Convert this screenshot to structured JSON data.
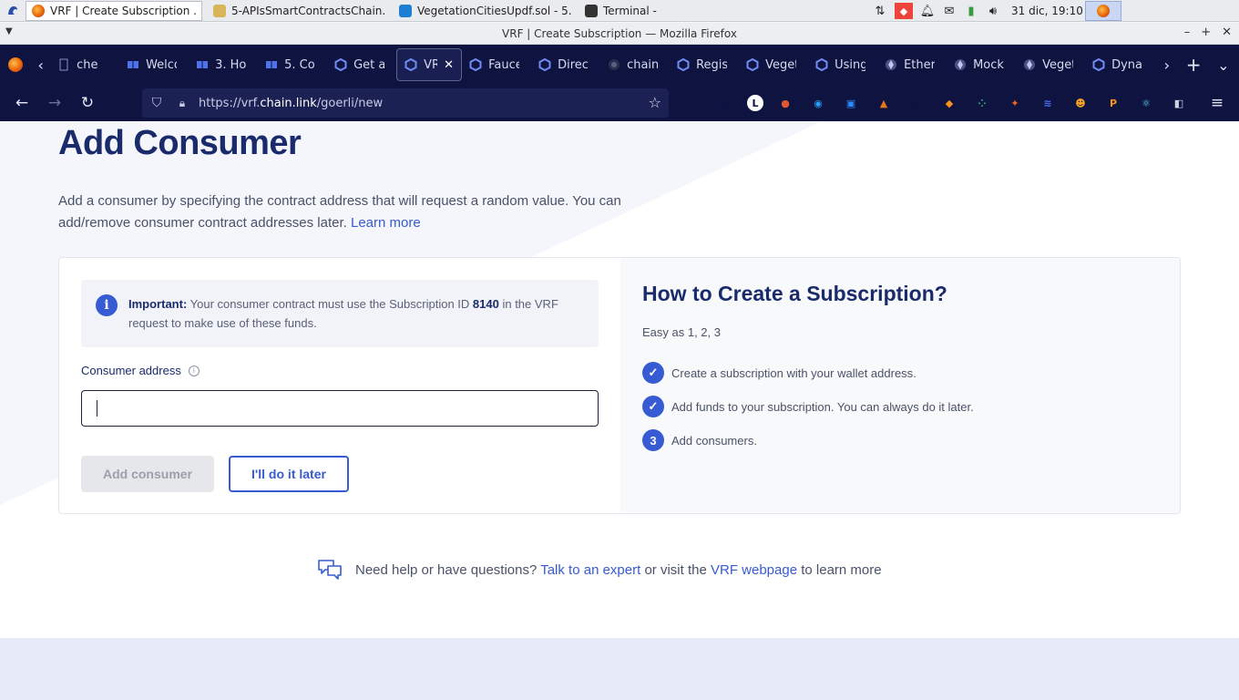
{
  "taskbar": {
    "tasks": [
      {
        "label": "VRF | Create Subscription ...",
        "color": "#e66000"
      },
      {
        "label": "5-APIsSmartContractsChain...",
        "color": "#d8b45a"
      },
      {
        "label": "VegetationCitiesUpdf.sol - 5...",
        "color": "#1f7fd3"
      },
      {
        "label": "Terminal -",
        "color": "#333333"
      }
    ],
    "clock": "31 dic, 19:10"
  },
  "window": {
    "title": "VRF | Create Subscription — Mozilla Firefox"
  },
  "tabs": [
    {
      "label": "che",
      "icon": "doc-icon"
    },
    {
      "label": "Welco",
      "icon": "book-icon"
    },
    {
      "label": "3. Ho",
      "icon": "book-icon"
    },
    {
      "label": "5. Co",
      "icon": "book-icon"
    },
    {
      "label": "Get a",
      "icon": "chainlink-icon"
    },
    {
      "label": "VRF",
      "icon": "chainlink-icon"
    },
    {
      "label": "Fauce",
      "icon": "chainlink-icon"
    },
    {
      "label": "Direct",
      "icon": "chainlink-icon"
    },
    {
      "label": "chainl",
      "icon": "github-icon"
    },
    {
      "label": "Regist",
      "icon": "chainlink-icon"
    },
    {
      "label": "Veget",
      "icon": "chainlink-icon"
    },
    {
      "label": "Using",
      "icon": "chainlink-icon"
    },
    {
      "label": "Ether",
      "icon": "ethereum-icon"
    },
    {
      "label": "Mock",
      "icon": "ethereum-icon"
    },
    {
      "label": "Veget",
      "icon": "ethereum-icon"
    },
    {
      "label": "Dynar",
      "icon": "chainlink-icon"
    }
  ],
  "url": {
    "prefix": "https://vrf.",
    "host": "chain.link",
    "path": "/goerli/new"
  },
  "extensions": [
    {
      "name": "pocket-icon",
      "color": "#0f1340",
      "glyph": "◙"
    },
    {
      "name": "l-extension-icon",
      "color": "#ffffff",
      "glyph": "L"
    },
    {
      "name": "duckduckgo-icon",
      "color": "#de5833",
      "glyph": "●"
    },
    {
      "name": "privacy-icon",
      "color": "#2a9df4",
      "glyph": "◉"
    },
    {
      "name": "zoom-icon",
      "color": "#2d8cff",
      "glyph": "▣"
    },
    {
      "name": "metamask-icon",
      "color": "#e2761b",
      "glyph": "▲"
    },
    {
      "name": "grid-icon",
      "color": "#0f1340",
      "glyph": "▦"
    },
    {
      "name": "shield-orange-icon",
      "color": "#f7931a",
      "glyph": "◆"
    },
    {
      "name": "dots-icon",
      "color": "#2fbf71",
      "glyph": "⁘"
    },
    {
      "name": "rocket-icon",
      "color": "#f26522",
      "glyph": "✦"
    },
    {
      "name": "layers-icon",
      "color": "#4a6cf7",
      "glyph": "≋"
    },
    {
      "name": "avatar-ext-icon",
      "color": "#f5a623",
      "glyph": "☻"
    },
    {
      "name": "coin-icon",
      "color": "#f7931a",
      "glyph": "P"
    },
    {
      "name": "react-icon",
      "color": "#61dafb",
      "glyph": "⚛"
    },
    {
      "name": "box-icon",
      "color": "#cfd2e4",
      "glyph": "◧"
    }
  ],
  "page": {
    "title": "Add Consumer",
    "intro": "Add a consumer by specifying the contract address that will request a random value. You can add/remove consumer contract addresses later.",
    "learn_more": "Learn more",
    "notice_bold": "Important:",
    "notice_pre": "Your consumer contract must use the Subscription ID",
    "sub_id": "8140",
    "notice_post": "in the VRF request to make use of these funds.",
    "address_label": "Consumer address",
    "address_value": "",
    "add_button": "Add consumer",
    "later_button": "I'll do it later",
    "how_title": "How to Create a Subscription?",
    "how_sub": "Easy as 1, 2, 3",
    "steps": [
      {
        "mark": "✓",
        "text": "Create a subscription with your wallet address."
      },
      {
        "mark": "✓",
        "text": "Add funds to your subscription. You can always do it later."
      },
      {
        "mark": "3",
        "text": "Add consumers."
      }
    ],
    "help_pre": "Need help or have questions?",
    "help_link1": "Talk to an expert",
    "help_mid": "or visit the",
    "help_link2": "VRF webpage",
    "help_post": "to learn more"
  }
}
